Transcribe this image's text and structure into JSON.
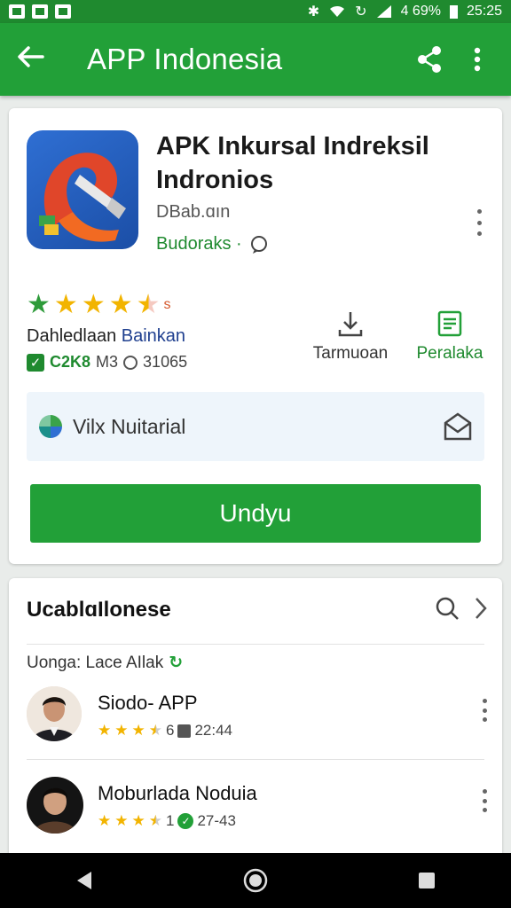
{
  "status_bar": {
    "battery": "4 69%",
    "time": "25:25"
  },
  "app_bar": {
    "title": "APP Indonesia",
    "icons": [
      "back-arrow-icon",
      "share-icon",
      "more-vert-icon"
    ]
  },
  "app_card": {
    "title": "APK Inkursal Indreksil Indronios",
    "developer_line1": "DBab.ɑın",
    "developer_line2": "Budoraks ·",
    "rating_stars": 4.5,
    "rating_suffix": "s",
    "rating_label_a": "Dahledlaan",
    "rating_label_b": "Bainkan",
    "size": "C2K8",
    "size_unit": "M3",
    "downloads": "31065",
    "action_download_label": "Tarmuoan",
    "action_details_label": "Peralaka",
    "feature_text": "Vilx Nuitarial",
    "install_label": "Undyu"
  },
  "section": {
    "title": "UcablɑIlonese",
    "subtitle": "Uonga: Lace AIlak",
    "items": [
      {
        "title": "Siodo- APP",
        "rating": 3.5,
        "mark": "6",
        "count": "22:44"
      },
      {
        "title": "Moburlada Noduia",
        "rating": 3.5,
        "mark": "1",
        "count": "27-43"
      }
    ]
  },
  "colors": {
    "status_bar": "#1f8a2f",
    "app_bar": "#22a038",
    "accent_green": "#22a038",
    "star": "#f2b400"
  }
}
